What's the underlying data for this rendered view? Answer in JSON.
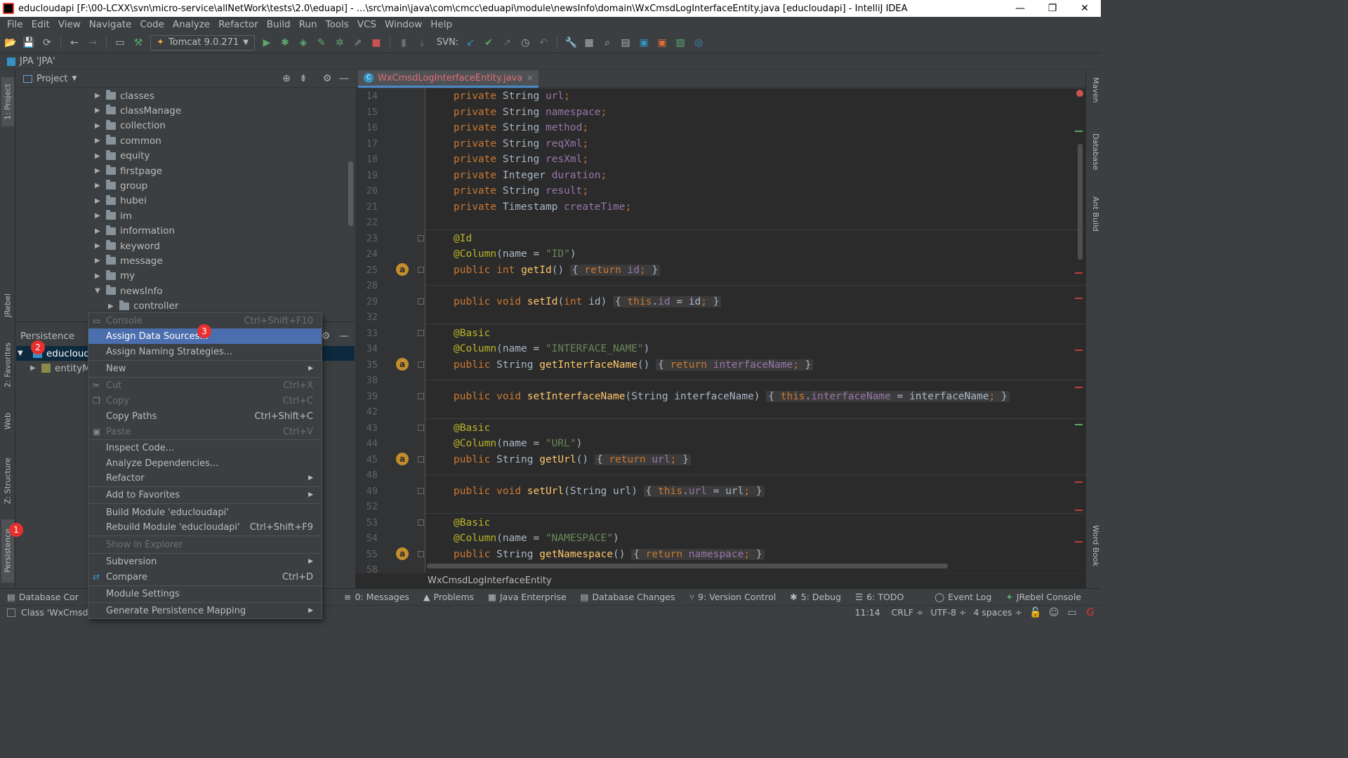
{
  "window": {
    "title": "educloudapi [F:\\00-LCXX\\svn\\micro-service\\allNetWork\\tests\\2.0\\eduapi] - ...\\src\\main\\java\\com\\cmcc\\eduapi\\module\\newsInfo\\domain\\WxCmsdLogInterfaceEntity.java [educloudapi] - IntelliJ IDEA",
    "minimize": "—",
    "restore": "❐",
    "close": "✕"
  },
  "menu": [
    "File",
    "Edit",
    "View",
    "Navigate",
    "Code",
    "Analyze",
    "Refactor",
    "Build",
    "Run",
    "Tools",
    "VCS",
    "Window",
    "Help"
  ],
  "toolbar": {
    "run_config": "Tomcat 9.0.271",
    "svn_label": "SVN:"
  },
  "navbar": {
    "label": "JPA 'JPA'"
  },
  "left_tabs": {
    "project": "1: Project",
    "jrebel": "JRebel",
    "favorites": "2: Favorites",
    "web": "Web",
    "structure": "Z: Structure",
    "persistence": "Persistence"
  },
  "right_tabs": {
    "maven": "Maven",
    "database": "Database",
    "ant": "Ant Build",
    "wordbook": "Word Book"
  },
  "project_panel": {
    "title": "Project",
    "folders": [
      "classes",
      "classManage",
      "collection",
      "common",
      "equity",
      "firstpage",
      "group",
      "hubei",
      "im",
      "information",
      "keyword",
      "message",
      "my",
      "newsInfo",
      "controller"
    ]
  },
  "persistence_panel": {
    "title": "Persistence",
    "root": "educlouda",
    "child": "entityM",
    "bottom_item": "Database Cor",
    "status_item": "Class 'WxCmsdL"
  },
  "editor": {
    "tab": "WxCmsdLogInterfaceEntity.java",
    "breadcrumb": "WxCmsdLogInterfaceEntity",
    "line_numbers": [
      "14",
      "15",
      "16",
      "17",
      "18",
      "19",
      "20",
      "21",
      "22",
      "23",
      "24",
      "25",
      "28",
      "29",
      "32",
      "33",
      "34",
      "35",
      "38",
      "39",
      "42",
      "43",
      "44",
      "45",
      "48",
      "49",
      "52",
      "53",
      "54",
      "55",
      "58"
    ],
    "lines": [
      {
        "kind": "field",
        "type": "String",
        "name": "url"
      },
      {
        "kind": "field",
        "type": "String",
        "name": "namespace"
      },
      {
        "kind": "field",
        "type": "String",
        "name": "method"
      },
      {
        "kind": "field",
        "type": "String",
        "name": "reqXml"
      },
      {
        "kind": "field",
        "type": "String",
        "name": "resXml"
      },
      {
        "kind": "field",
        "type": "Integer",
        "name": "duration"
      },
      {
        "kind": "field",
        "type": "String",
        "name": "result"
      },
      {
        "kind": "field",
        "type": "Timestamp",
        "name": "createTime"
      }
    ],
    "kw_private": "private",
    "kw_public": "public",
    "kw_int": "int",
    "kw_return": "return",
    "kw_this": "this",
    "ann_id": "@Id",
    "ann_basic": "@Basic",
    "ann_column": "@Column",
    "col_id": "\"ID\"",
    "col_interface": "\"INTERFACE_NAME\"",
    "col_url": "\"URL\"",
    "col_namespace": "\"NAMESPACE\"",
    "gutter_badge": "a"
  },
  "context_menu": {
    "items": [
      {
        "label": "Console",
        "shortcut": "Ctrl+Shift+F10",
        "disabled": true
      },
      {
        "label": "Assign Data Sources...",
        "shortcut": "",
        "highlighted": true
      },
      {
        "label": "Assign Naming Strategies...",
        "shortcut": ""
      },
      {
        "label": "New",
        "shortcut": "",
        "submenu": true
      },
      {
        "label": "Cut",
        "shortcut": "Ctrl+X",
        "disabled": true
      },
      {
        "label": "Copy",
        "shortcut": "Ctrl+C",
        "disabled": true
      },
      {
        "label": "Copy Paths",
        "shortcut": "Ctrl+Shift+C"
      },
      {
        "label": "Paste",
        "shortcut": "Ctrl+V",
        "disabled": true
      },
      {
        "label": "Inspect Code...",
        "shortcut": ""
      },
      {
        "label": "Analyze Dependencies...",
        "shortcut": ""
      },
      {
        "label": "Refactor",
        "shortcut": "",
        "submenu": true
      },
      {
        "label": "Add to Favorites",
        "shortcut": "",
        "submenu": true
      },
      {
        "label": "Build Module 'educloudapi'",
        "shortcut": ""
      },
      {
        "label": "Rebuild Module 'educloudapi'",
        "shortcut": "Ctrl+Shift+F9"
      },
      {
        "label": "Show in Explorer",
        "shortcut": "",
        "disabled": true
      },
      {
        "label": "Subversion",
        "shortcut": "",
        "submenu": true
      },
      {
        "label": "Compare",
        "shortcut": "Ctrl+D"
      },
      {
        "label": "Module Settings",
        "shortcut": ""
      },
      {
        "label": "Generate Persistence Mapping",
        "shortcut": "",
        "submenu": true
      }
    ]
  },
  "badges": [
    "1",
    "2",
    "3"
  ],
  "bottom_tabs": [
    "0: Messages",
    "Problems",
    "Java Enterprise",
    "Database Changes",
    "9: Version Control",
    "5: Debug",
    "6: TODO",
    "Event Log",
    "JRebel Console"
  ],
  "status": {
    "position": "11:14",
    "line_sep": "CRLF ÷",
    "encoding": "UTF-8 ÷",
    "indent": "4 spaces ÷"
  },
  "colors": {
    "accent": "#4b6eaf",
    "badge": "#e8312f",
    "tab_underline": "#4a88c7"
  }
}
